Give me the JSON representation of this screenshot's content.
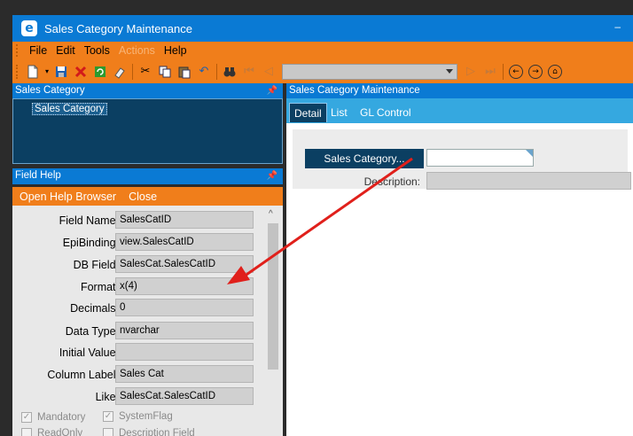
{
  "window": {
    "title": "Sales Category Maintenance",
    "app_icon": "e",
    "min_button": "–"
  },
  "menu": [
    {
      "label": "File",
      "disabled": false
    },
    {
      "label": "Edit",
      "disabled": false
    },
    {
      "label": "Tools",
      "disabled": false
    },
    {
      "label": "Actions",
      "disabled": true
    },
    {
      "label": "Help",
      "disabled": false
    }
  ],
  "left_top_pane": {
    "title": "Sales Category",
    "tree_item": "Sales Category"
  },
  "field_help": {
    "title": "Field Help",
    "open_browser": "Open Help Browser",
    "close": "Close",
    "rows": [
      {
        "label": "Field Name:",
        "value": "SalesCatID"
      },
      {
        "label": "EpiBinding:",
        "value": "view.SalesCatID"
      },
      {
        "label": "DB Field:",
        "value": "SalesCat.SalesCatID"
      },
      {
        "label": "Format:",
        "value": "x(4)"
      },
      {
        "label": "Decimals:",
        "value": "0"
      },
      {
        "label": "Data Type:",
        "value": "nvarchar"
      },
      {
        "label": "Initial Value:",
        "value": ""
      },
      {
        "label": "Column Label:",
        "value": "Sales Cat"
      },
      {
        "label": "Like:",
        "value": "SalesCat.SalesCatID"
      }
    ],
    "checkboxes": [
      {
        "label": "Mandatory",
        "checked": true
      },
      {
        "label": "SystemFlag",
        "checked": true
      },
      {
        "label": "ReadOnly",
        "checked": false
      },
      {
        "label": "Description Field",
        "checked": false
      }
    ]
  },
  "right_pane": {
    "title": "Sales Category Maintenance",
    "tabs": [
      "Detail",
      "List",
      "GL Control"
    ],
    "sales_category_button": "Sales Category...",
    "sales_category_value": "",
    "description_label": "Description:",
    "description_value": ""
  },
  "annotation": {
    "arrow_color": "#e0201b"
  }
}
